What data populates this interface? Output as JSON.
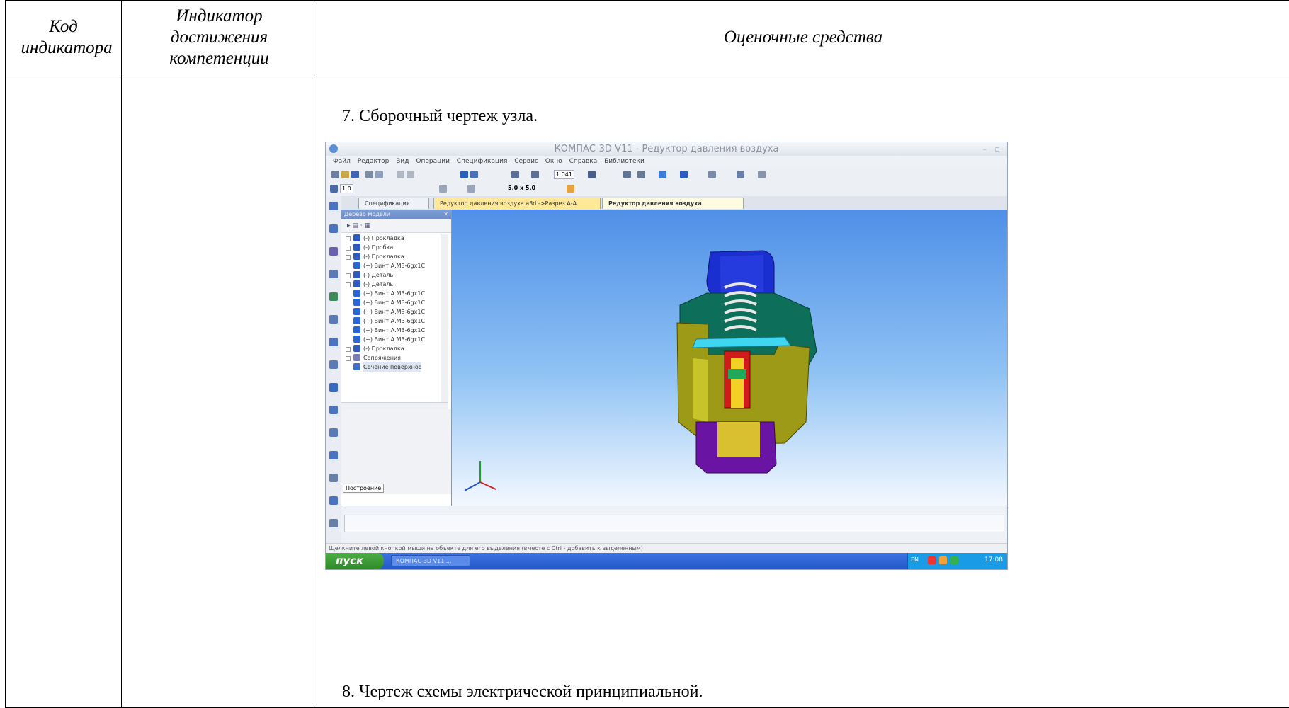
{
  "table": {
    "col1_header": "Код индикатора",
    "col2_header_lines": [
      "Индикатор",
      "достижения",
      "компетенции"
    ],
    "col3_header": "Оценочные средства"
  },
  "items": {
    "item7": "7. Сборочный чертеж узла.",
    "item8": "8. Чертеж схемы электрической принципиальной."
  },
  "screenshot": {
    "window_title": "КОМПАС-3D V11 - Редуктор давления воздуха",
    "menu": [
      "Файл",
      "Редактор",
      "Вид",
      "Операции",
      "Спецификация",
      "Сервис",
      "Окно",
      "Справка",
      "Библиотеки"
    ],
    "zoom_value": "1.041",
    "line_weight": "1.0",
    "grid_step": "5.0 x 5.0",
    "tabs": [
      "Спецификация",
      "Редуктор давления воздуха.a3d ->Разрез А-А",
      "Редуктор давления воздуха"
    ],
    "tree_panel_title": "Дерево модели",
    "tree_items": [
      "(-) Прокладка",
      "(-) Пробка",
      "(-) Прокладка",
      "(+) Винт А.М3-6gx1С",
      "(-) Деталь",
      "(-) Деталь",
      "(+) Винт А.М3-6gx1С",
      "(+) Винт А.М3-6gx1С",
      "(+) Винт А.М3-6gx1С",
      "(+) Винт А.М3-6gx1С",
      "(+) Винт А.М3-6gx1С",
      "(+) Винт А.М3-6gx1С",
      "(-) Прокладка",
      "Сопряжения",
      "Сечение поверхнос"
    ],
    "tree_tab": "Построение",
    "status_text": "Щелкните левой кнопкой мыши на объекте для его выделения (вместе с Ctrl - добавить к выделенным)",
    "start_label": "пуск",
    "taskbar_item": "КОМПАС-3D V11 ...",
    "tray_lang": "EN",
    "clock": "17:08",
    "accent_colors": {
      "cap_blue": "#1b2fd0",
      "body_olive": "#9c9a16",
      "housing_green": "#0d6e5a",
      "base_purple": "#6a14a3",
      "valve_red": "#d11a1a",
      "viewport_top": "#4f8fe7"
    }
  }
}
